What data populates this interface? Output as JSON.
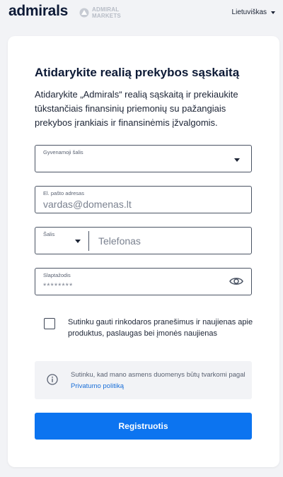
{
  "header": {
    "logo_text": "admirals",
    "secondary_logo_line1": "ADMIRAL",
    "secondary_logo_line2": "MARKETS",
    "language_label": "Lietuviškas"
  },
  "form": {
    "title": "Atidarykite realią prekybos sąskaitą",
    "intro": "Atidarykite „Admirals“ realią sąskaitą ir prekiaukite tūkstančiais finansinių priemonių su pažangiais prekybos įrankiais ir finansinėmis įžvalgomis.",
    "country_field": {
      "label": "Gyvenamoji šalis",
      "value": ""
    },
    "email_field": {
      "label": "El. pašto adresas",
      "placeholder": "vardas@domenas.lt"
    },
    "phone_field": {
      "country_label": "Šalis",
      "placeholder": "Telefonas"
    },
    "password_field": {
      "label": "Slaptažodis",
      "placeholder": "********"
    },
    "newsletter_checkbox": {
      "checked": false,
      "text": "Sutinku gauti rinkodaros pranešimus ir naujienas apie produktus, paslaugas bei įmonės naujienas"
    },
    "privacy_notice": {
      "text": "Sutinku, kad mano asmens duomenys būtų tvarkomi pagal ",
      "link_text": "Privatumo politiką"
    },
    "submit_label": "Registruotis"
  },
  "colors": {
    "primary_button": "#0c74f0",
    "link": "#1a6fd8",
    "page_background": "#f2f3f6"
  }
}
